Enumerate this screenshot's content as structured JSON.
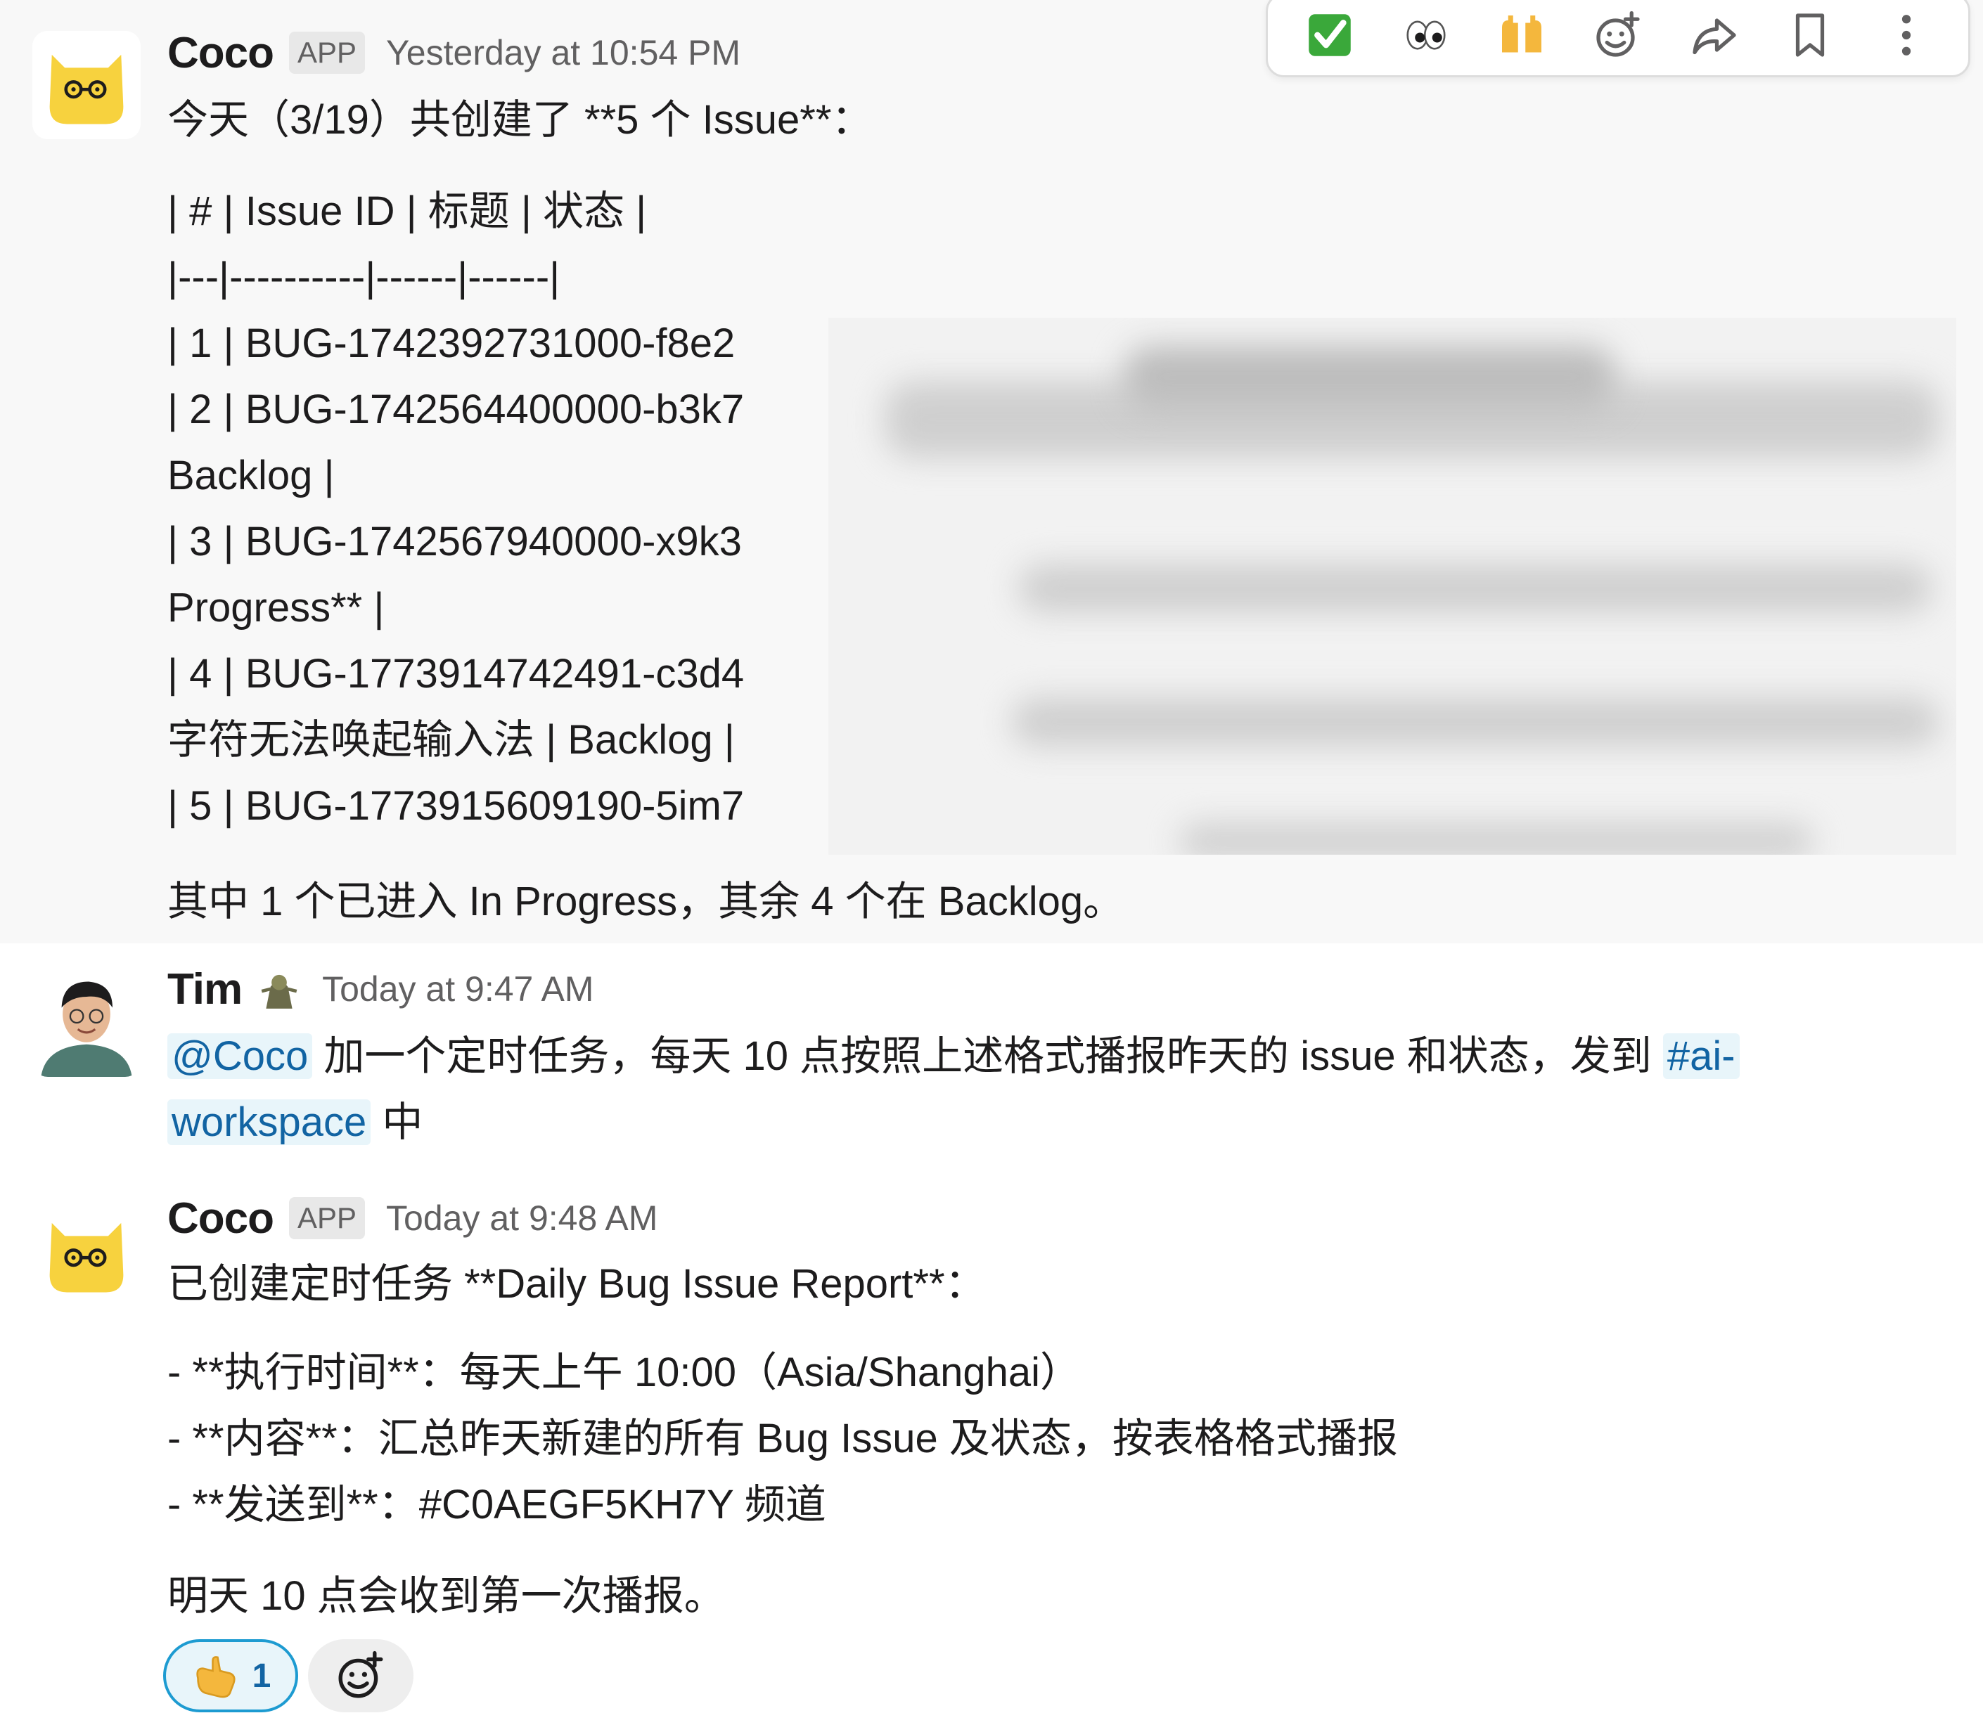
{
  "message1": {
    "sender": "Coco",
    "badge": "APP",
    "timestamp": "Yesterday at 10:54 PM",
    "lines": [
      "今天（3/19）共创建了 **5 个 Issue**：",
      "| # | Issue ID | 标题 | 状态 |",
      "|---|----------|------|------|",
      "| 1 | BUG-1742392731000-f8e2",
      "| 2 | BUG-1742564400000-b3k7",
      "Backlog |",
      "| 3 | BUG-1742567940000-x9k3",
      "Progress** |",
      "| 4 | BUG-1773914742491-c3d4",
      "字符无法唤起输入法 | Backlog |",
      "| 5 | BUG-1773915609190-5im7",
      "其中 1 个已进入 In Progress，其余 4 个在 Backlog。"
    ]
  },
  "toolbar": {
    "icons": [
      "white-check-mark-icon",
      "eyes-icon",
      "raised-hands-icon",
      "add-reaction-icon",
      "share-icon",
      "bookmark-icon",
      "more-actions-icon"
    ]
  },
  "message2": {
    "sender": "Tim",
    "timestamp": "Today at 9:47 AM",
    "mention": "@Coco",
    "text_part1": " 加一个定时任务，每天 10 点按照上述格式播报昨天的 issue 和状态，发到 ",
    "channel_part1": "#ai-",
    "channel_part2": "workspace",
    "text_part2": " 中"
  },
  "message3": {
    "sender": "Coco",
    "badge": "APP",
    "timestamp": "Today at 9:48 AM",
    "lines": [
      "已创建定时任务 **Daily Bug Issue Report**：",
      "- **执行时间**：每天上午 10:00（Asia/Shanghai）",
      "- **内容**：汇总昨天新建的所有 Bug Issue 及状态，按表格格式播报",
      "- **发送到**：#C0AEGF5KH7Y 频道",
      "明天 10 点会收到第一次播报。"
    ],
    "reaction_count": "1"
  },
  "colors": {
    "link": "#1264a3",
    "mention_bg": "#e8f5fa",
    "hover_bg": "#f8f8f8",
    "timestamp": "#616061",
    "coco_yellow": "#f7d23e"
  }
}
